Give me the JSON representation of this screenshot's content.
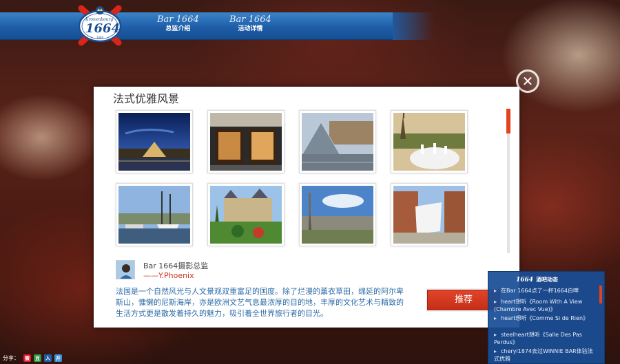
{
  "header": {
    "logo": {
      "brand": "Kronenbourg",
      "number": "1664",
      "year": "1664"
    },
    "nav": [
      {
        "brand": "Bar 1664",
        "label": "总监介绍"
      },
      {
        "brand": "Bar 1664",
        "label": "活动详情"
      }
    ]
  },
  "modal": {
    "title": "法式优雅风景",
    "close_icon": "close-icon",
    "photos": [
      {
        "icon": "photo-louvre-night"
      },
      {
        "icon": "photo-louis-vuitton-store"
      },
      {
        "icon": "photo-louvre-pyramid-day"
      },
      {
        "icon": "photo-eiffel-tower-terrace"
      },
      {
        "icon": "photo-tall-ship-harbor"
      },
      {
        "icon": "photo-chateau-garden"
      },
      {
        "icon": "photo-paris-skyline"
      },
      {
        "icon": "photo-city-square-pavilion"
      }
    ],
    "author": {
      "title": "Bar 1664摄影总监",
      "name": "——Y.Phoenix"
    },
    "description": "法国是一个自然风光与人文景观双重富足的国度。除了烂漫的薰衣草田，绵延的阿尔卑斯山，慵懒的尼斯海岸，亦是欧洲文艺气息最浓厚的目的地，丰厚的文化艺术与精致的生活方式更是散发着持久的魅力，吸引着全世界旅行者的目光。",
    "recommend_label": "推荐"
  },
  "news": {
    "brand": "1664",
    "title": "酒吧动态",
    "items": [
      "在Bar 1664点了一杯1664白啤",
      "heart想听《Room With A View (Chambre Avec Vue)》",
      "heart想听《Comme Si de Rien》",
      "steelheart想听《Salle Des Pas Perdus》",
      "cheryl1874去过WINNIE BAR体验法式优雅"
    ]
  },
  "share": {
    "label": "分享：",
    "icons": [
      {
        "name": "weibo-icon",
        "glyph": "微",
        "color": "#e6162d"
      },
      {
        "name": "douban-icon",
        "glyph": "豆",
        "color": "#2e963d"
      },
      {
        "name": "renren-icon",
        "glyph": "人",
        "color": "#1f5fa8"
      },
      {
        "name": "kaixin-icon",
        "glyph": "开",
        "color": "#3a8fd6"
      }
    ]
  },
  "colors": {
    "header_blue": "#1e5ea8",
    "accent_red": "#e2421d",
    "text_blue": "#2d6ca8"
  }
}
